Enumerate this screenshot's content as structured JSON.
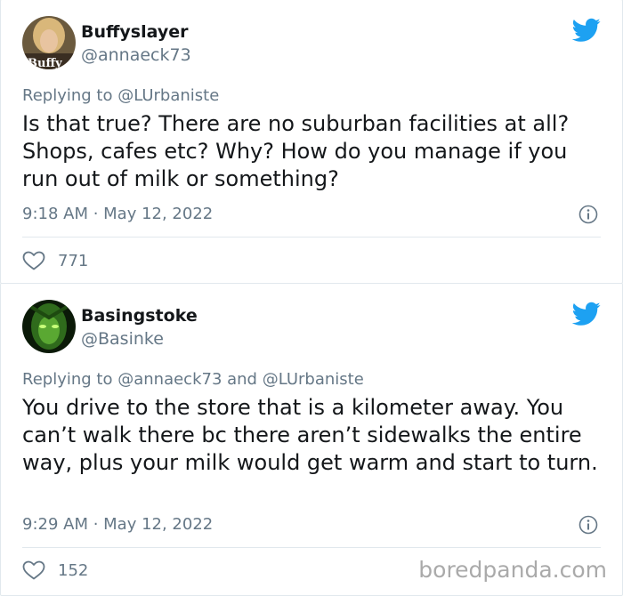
{
  "tweets": [
    {
      "name": "Buffyslayer",
      "handle": "@annaeck73",
      "reply_prefix": "Replying to",
      "reply_mentions": "@LUrbaniste",
      "text": "Is that true? There are no suburban facilities at all? Shops, cafes etc? Why? How do you manage if you run out of milk or something?",
      "timestamp": "9:18 AM · May 12, 2022",
      "likes": "771",
      "avatar_caption": "Buffy"
    },
    {
      "name": "Basingstoke",
      "handle": "@Basinke",
      "reply_prefix": "Replying to",
      "reply_mentions": "@annaeck73 and @LUrbaniste",
      "text": "You drive to the store that is a kilometer away. You can’t walk there bc there aren’t sidewalks the entire way, plus your milk would get warm and start to turn.",
      "timestamp": "9:29 AM · May 12, 2022",
      "likes": "152"
    }
  ],
  "watermark": "boredpanda.com",
  "colors": {
    "brand_blue": "#1da1f2",
    "muted": "#657786",
    "text": "#14171a",
    "border": "#e1e8ed"
  },
  "icons": [
    "twitter-bird-icon",
    "info-icon",
    "heart-icon"
  ]
}
